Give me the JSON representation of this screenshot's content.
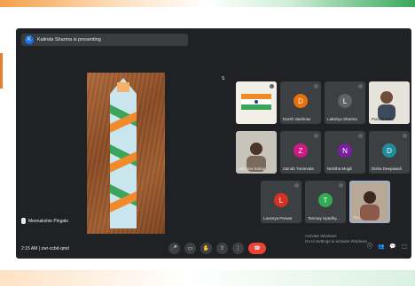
{
  "presenting": {
    "avatar_letter": "K",
    "text": "Kalinda Sharma is presenting"
  },
  "main": {
    "name": "Meenakshie Pingale"
  },
  "top_label": "S",
  "participants": [
    {
      "name": "",
      "letter": "",
      "color": "",
      "video": true
    },
    {
      "name": "Darsh Vaishnav",
      "letter": "D",
      "color": "#e8710a"
    },
    {
      "name": "Lakshya Sharma",
      "letter": "L",
      "color": "#5f6368"
    },
    {
      "name": "Purohit Kant",
      "letter": "",
      "color": "",
      "video": true
    },
    {
      "name": "Mahima Sahay",
      "letter": "",
      "color": "",
      "video": true,
      "dark": true
    },
    {
      "name": "Zainab Turnevala",
      "letter": "Z",
      "color": "#d01884"
    },
    {
      "name": "Nishtha Mogili",
      "letter": "N",
      "color": "#7b1fa2"
    },
    {
      "name": "Disha Deepawali",
      "letter": "D",
      "color": "#1e8e9e"
    },
    {
      "name": "Lavanya Parwar",
      "letter": "L",
      "color": "#d93025"
    },
    {
      "name": "Tanmay Upadhy...",
      "letter": "T",
      "color": "#34a853"
    },
    {
      "name": "You",
      "letter": "",
      "color": "",
      "video": true
    }
  ],
  "bottom": {
    "time_code": "2:15 AM  |  zwr-ccbd-qmd"
  },
  "activate": {
    "line1": "Activate Windows",
    "line2": "Go to Settings to activate Windows."
  },
  "controls": {
    "mic": "🎤",
    "cam": "▭",
    "hand": "✋",
    "present": "⇪",
    "more": "⋮",
    "end": "☎"
  },
  "right_icons": [
    "ⓘ",
    "👥",
    "💬",
    "⬚"
  ]
}
